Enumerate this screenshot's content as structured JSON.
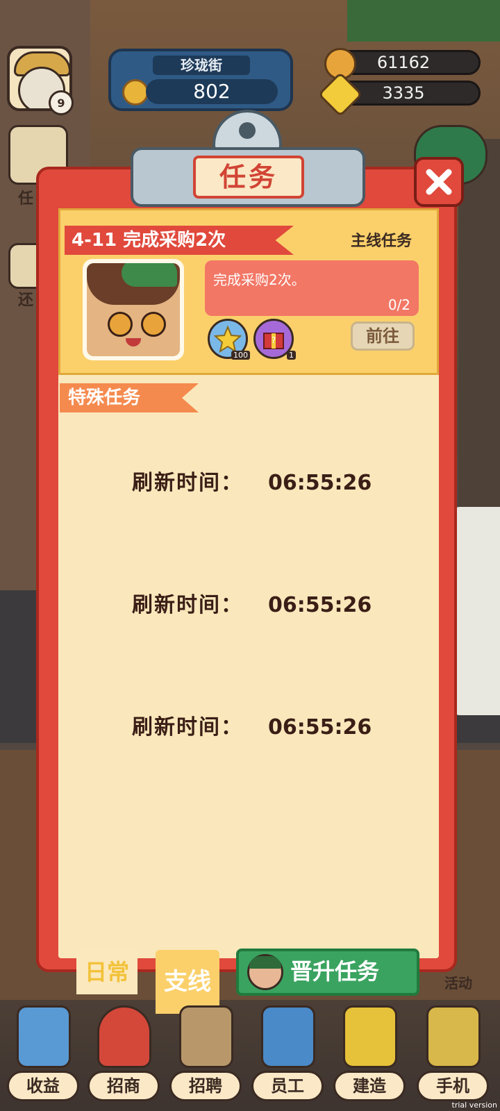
{
  "player": {
    "level": "9",
    "street_name": "珍珑街",
    "street_value": "802"
  },
  "resources": {
    "coins": "61162",
    "stars": "3335"
  },
  "modal": {
    "title": "任务",
    "main_task": {
      "ribbon": "4-11 完成采购2次",
      "type": "主线任务",
      "description": "完成采购2次。",
      "progress": "0/2",
      "rewards": [
        {
          "icon": "star-reward-icon",
          "count": "100"
        },
        {
          "icon": "mystery-gift-box-icon",
          "count": "1"
        }
      ],
      "go_button": "前往"
    },
    "special_header": "特殊任务",
    "refresh_rows": [
      {
        "label": "刷新时间：",
        "time": "06:55:26"
      },
      {
        "label": "刷新时间：",
        "time": "06:55:26"
      },
      {
        "label": "刷新时间：",
        "time": "06:55:26"
      }
    ]
  },
  "tabs": {
    "daily": "日常",
    "branch": "支线",
    "promotion": "晋升任务"
  },
  "bottom_nav": [
    {
      "label": "收益",
      "icon": "cash-register-icon",
      "color": "#5a9ad4"
    },
    {
      "label": "招商",
      "icon": "lucky-bag-icon",
      "color": "#d4483a"
    },
    {
      "label": "招聘",
      "icon": "newspaper-icon",
      "color": "#b8986a"
    },
    {
      "label": "员工",
      "icon": "employee-card-icon",
      "color": "#4a8ac8"
    },
    {
      "label": "建造",
      "icon": "building-icon",
      "color": "#e6c23a"
    },
    {
      "label": "手机",
      "icon": "phone-icon",
      "color": "#d8b84a"
    }
  ],
  "side_labels": {
    "left_partial_1": "任",
    "left_partial_2": "还",
    "right_activity": "活动"
  },
  "watermark": "trial version",
  "colors": {
    "modal_red": "#e0493c",
    "paper": "#fae8bc",
    "card_yellow": "#fbd06b",
    "special_orange": "#f58a4e"
  }
}
